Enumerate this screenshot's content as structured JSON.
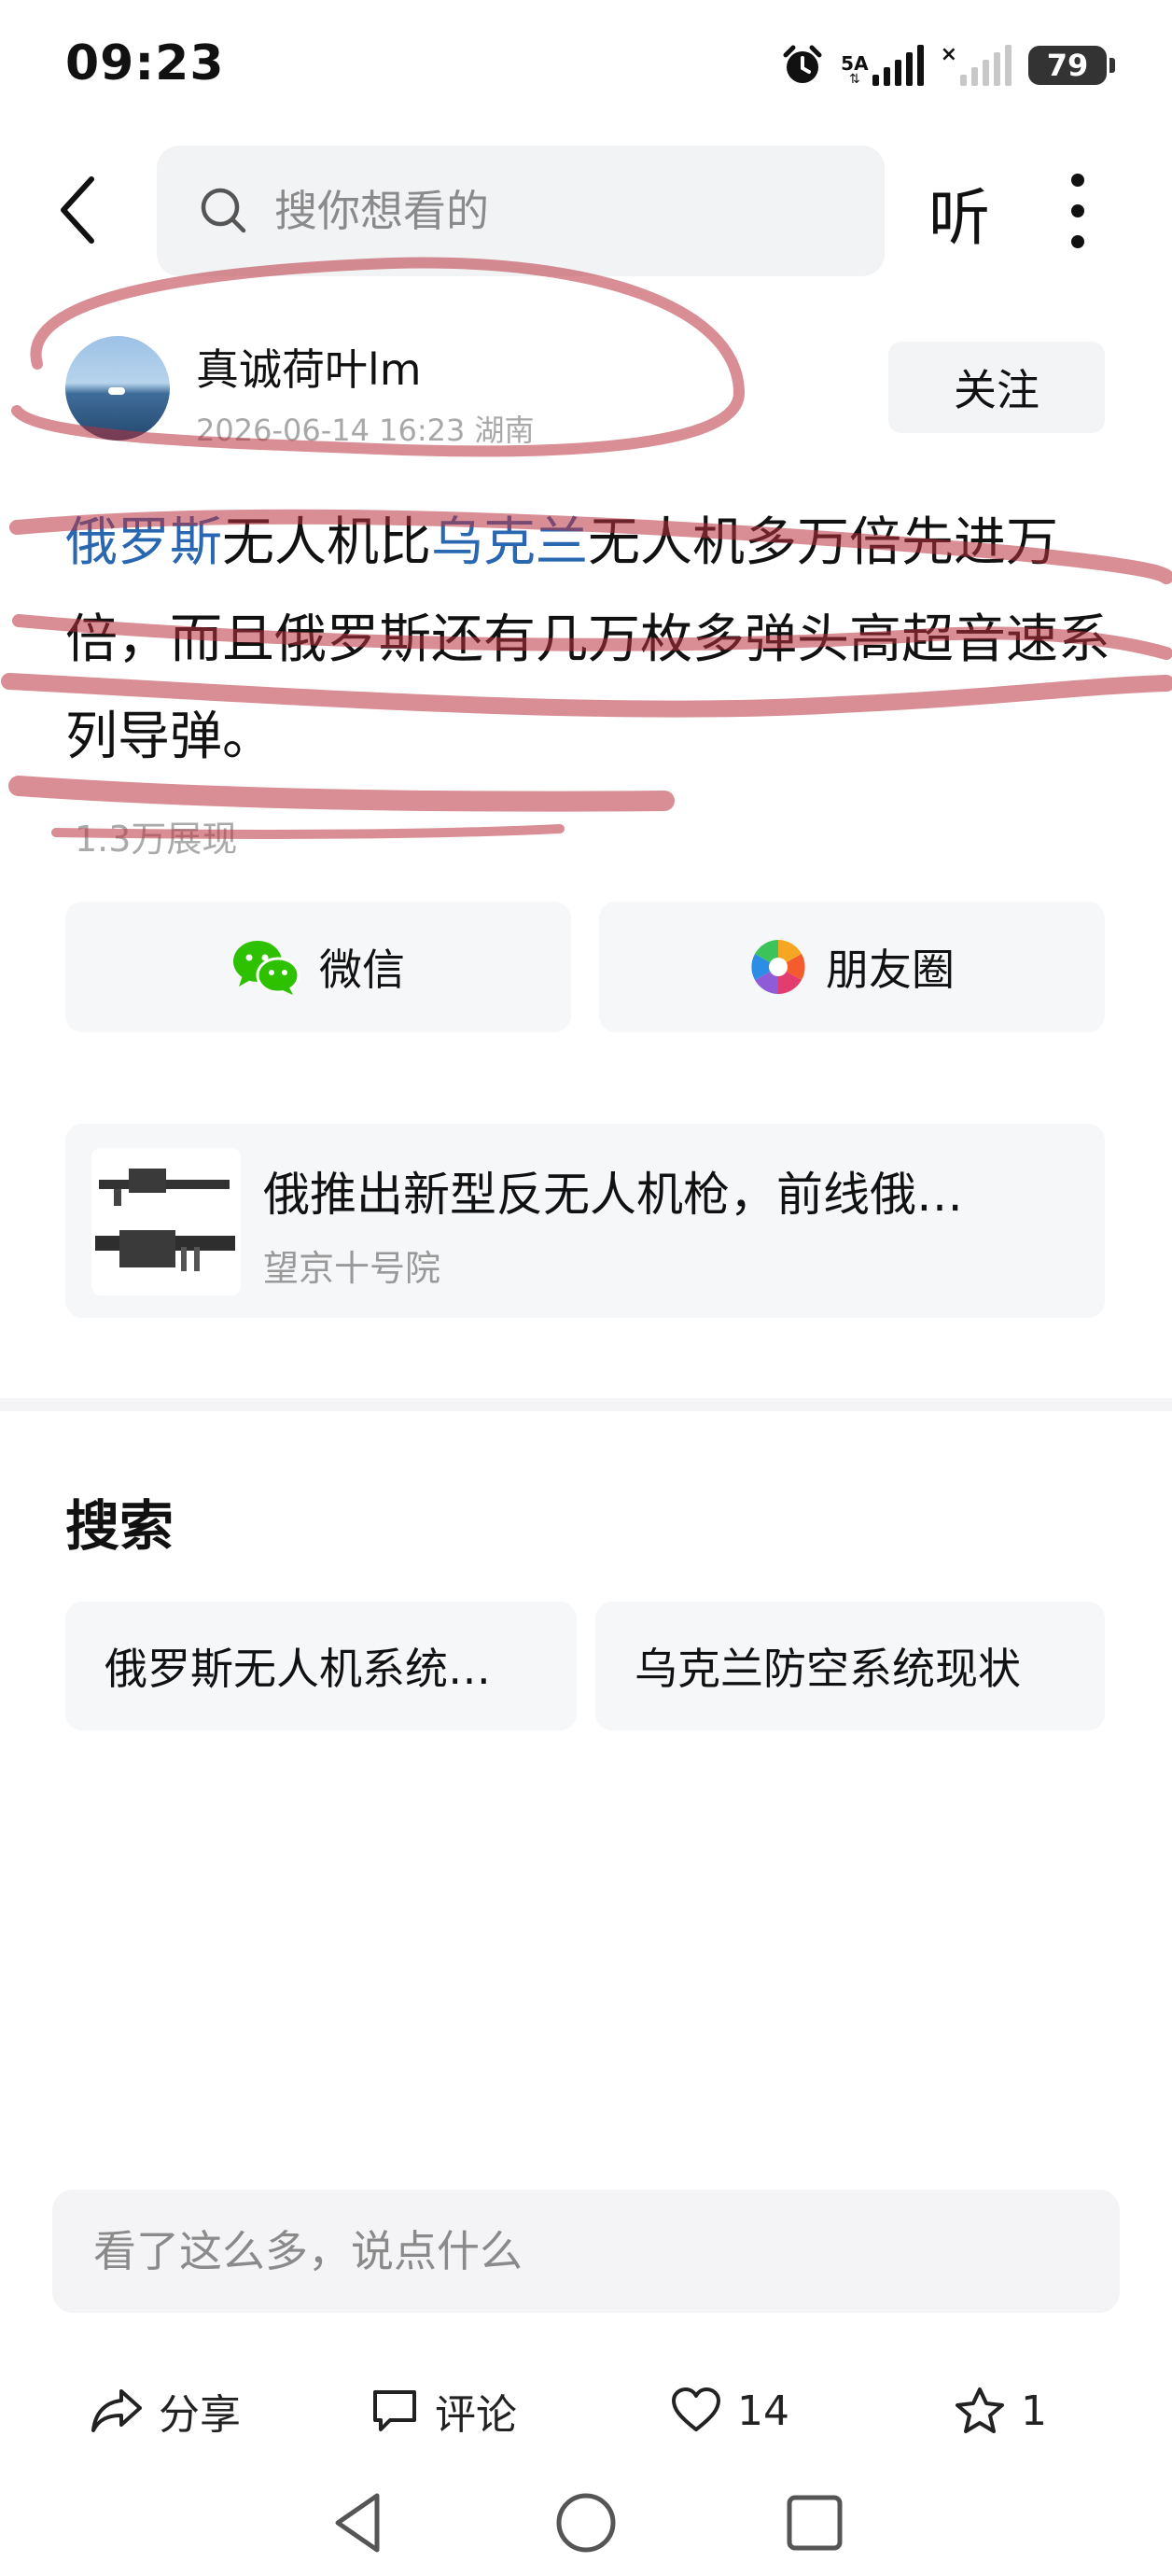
{
  "status": {
    "time": "09:23",
    "network": "5A",
    "battery": "79"
  },
  "search": {
    "placeholder": "搜你想看的"
  },
  "header": {
    "listen_label": "听"
  },
  "author": {
    "name": "真诚荷叶lm",
    "meta": "2026-06-14 16:23 湖南",
    "follow_label": "关注"
  },
  "post": {
    "parts": [
      {
        "text": "俄罗斯",
        "link": true
      },
      {
        "text": "无人机比",
        "link": false
      },
      {
        "text": "乌克兰",
        "link": true
      },
      {
        "text": "无人机多万倍先进万倍，而且俄罗斯还有几万枚多弹头高超音速系列导弹。",
        "link": false
      }
    ],
    "views": "1.3万展现"
  },
  "share": {
    "wechat": "微信",
    "moments": "朋友圈"
  },
  "related": {
    "title": "俄推出新型反无人机枪，前线俄…",
    "source": "望京十号院"
  },
  "search_section": {
    "heading": "搜索",
    "chips": [
      "俄罗斯无人机系统…",
      "乌克兰防空系统现状"
    ]
  },
  "comment": {
    "placeholder": "看了这么多，说点什么"
  },
  "actions": {
    "share": "分享",
    "comment": "评论",
    "likes": "14",
    "favorites": "1"
  },
  "colors": {
    "link": "#2a67b1",
    "annotation": "#b8323c",
    "wechat": "#2dc100"
  }
}
